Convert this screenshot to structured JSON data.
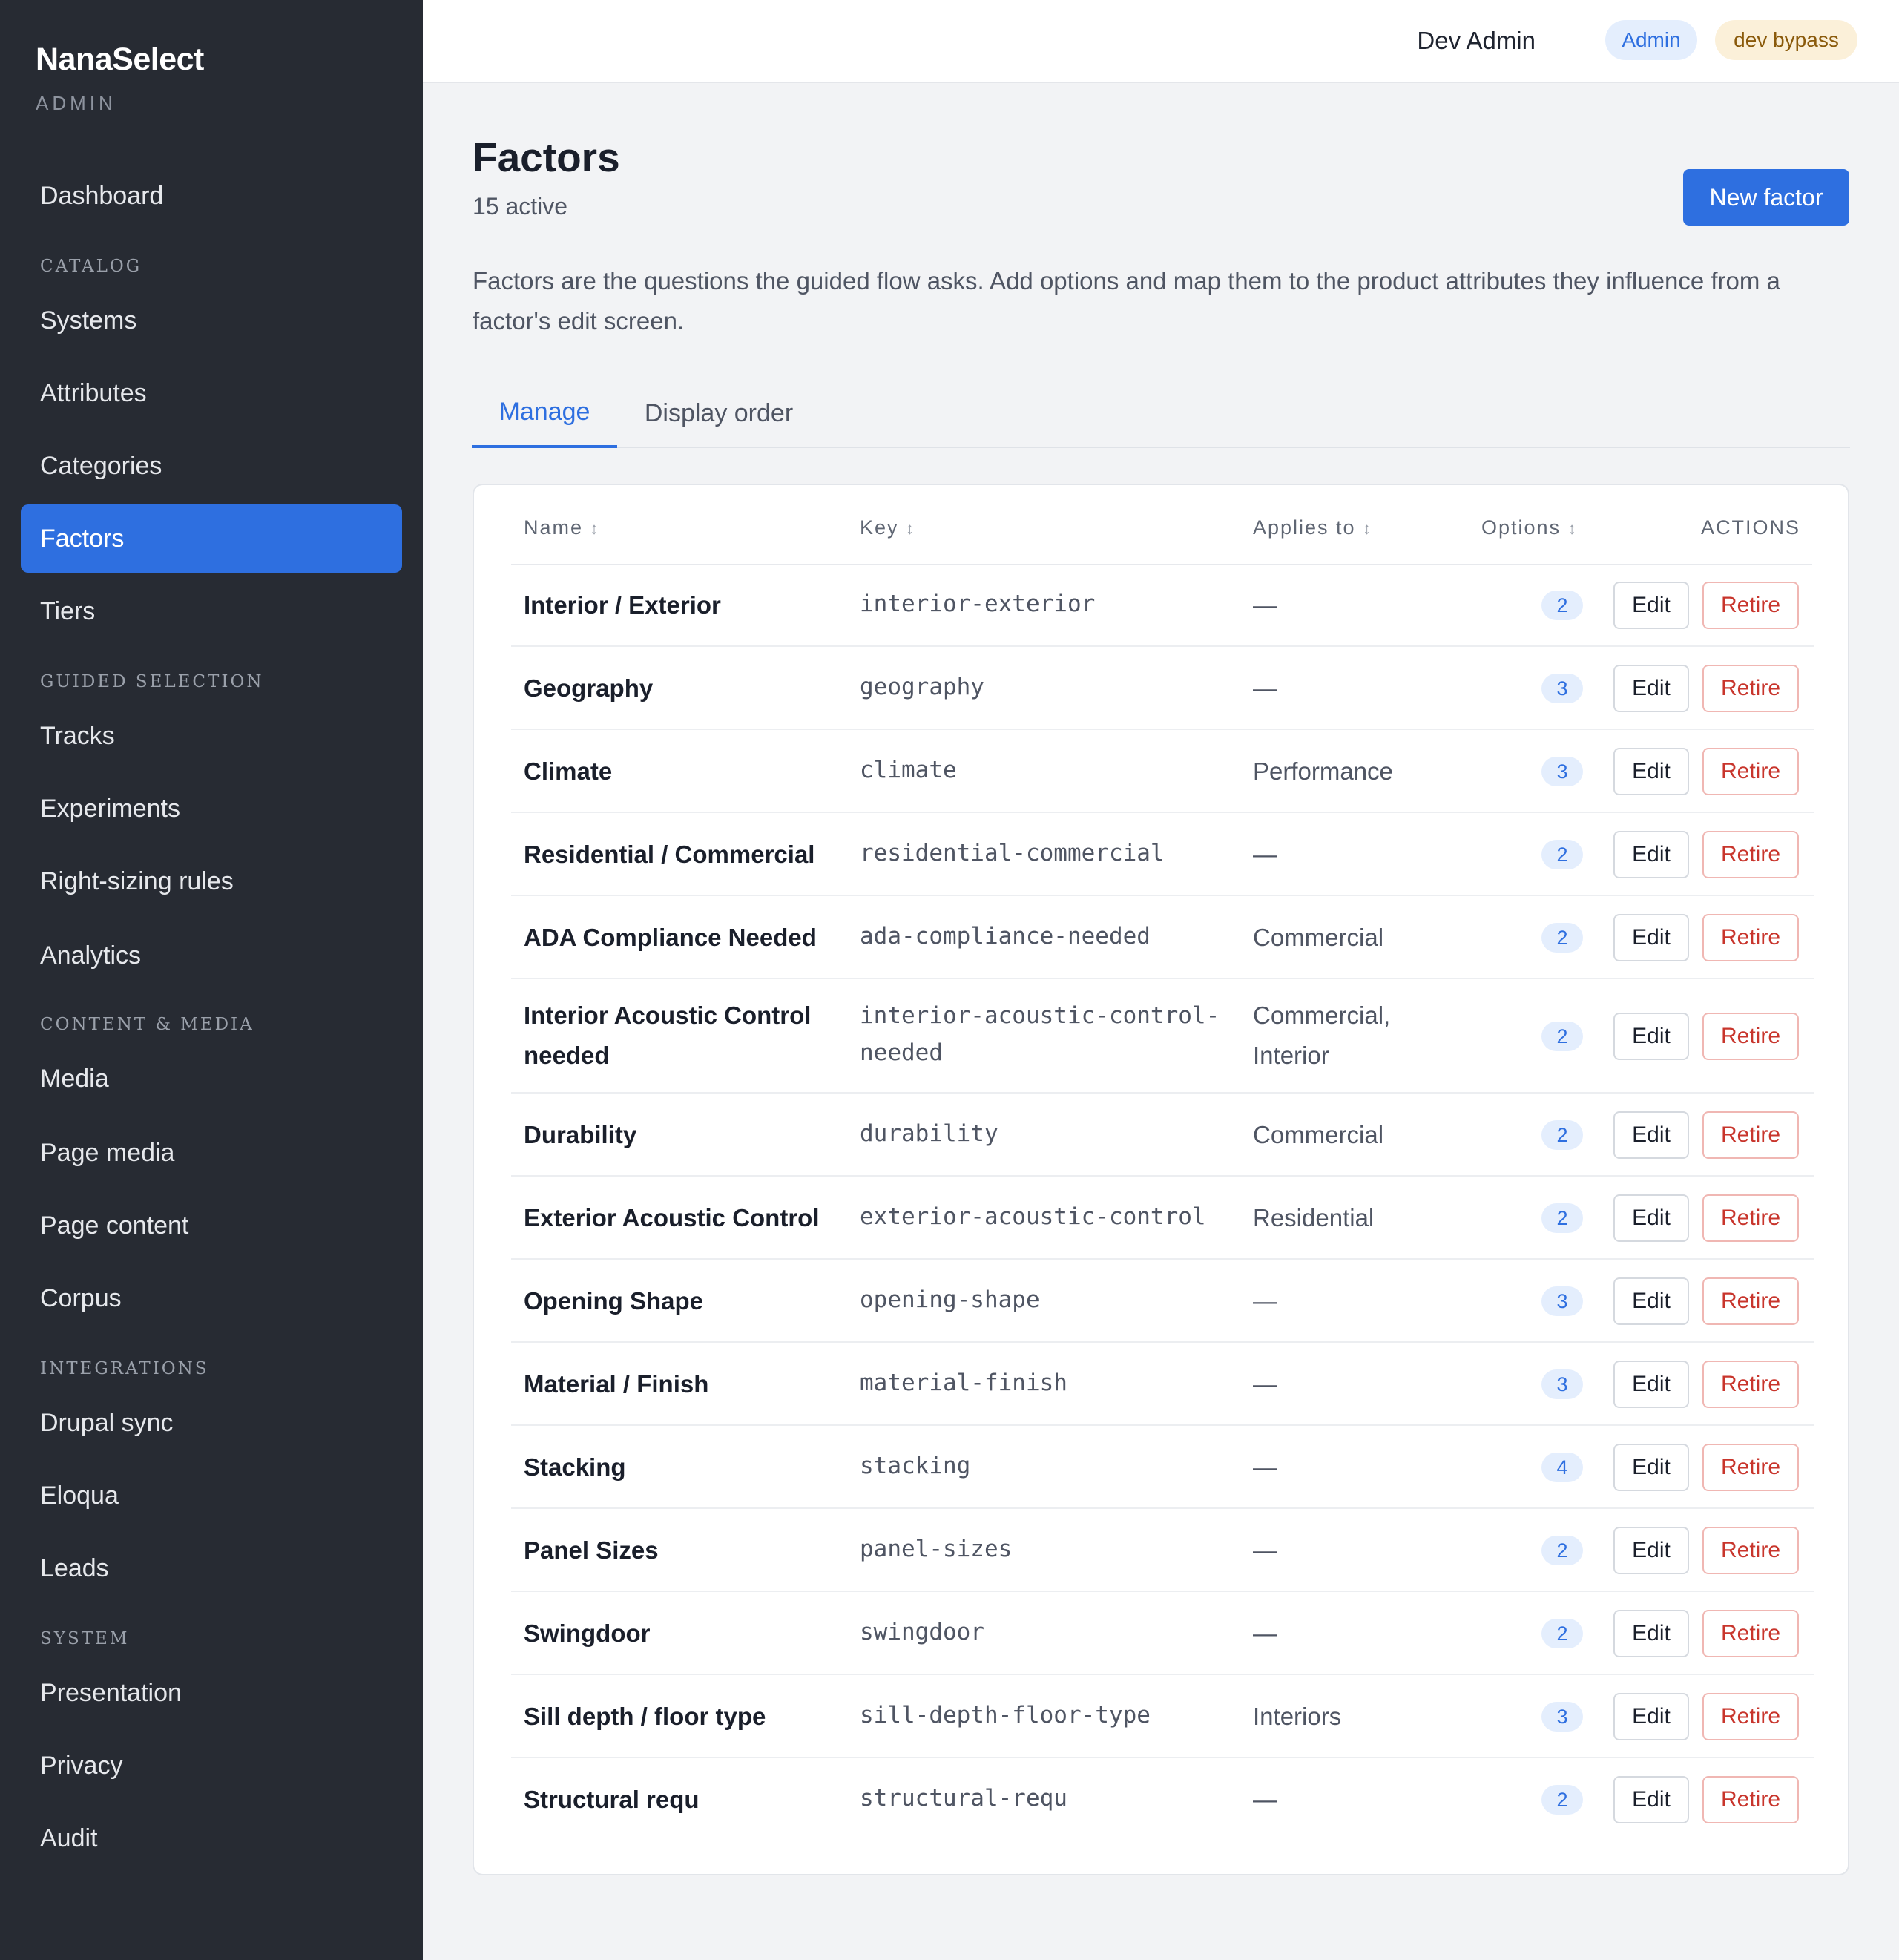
{
  "sidebar": {
    "brand": "NanaSelect",
    "brand_sub": "ADMIN",
    "dashboard": "Dashboard",
    "sections": {
      "catalog": "CATALOG",
      "guided": "GUIDED SELECTION",
      "content": "CONTENT & MEDIA",
      "integrations": "INTEGRATIONS",
      "system": "SYSTEM"
    },
    "items": {
      "systems": "Systems",
      "attributes": "Attributes",
      "categories": "Categories",
      "factors": "Factors",
      "tiers": "Tiers",
      "tracks": "Tracks",
      "experiments": "Experiments",
      "right_sizing": "Right-sizing rules",
      "analytics": "Analytics",
      "media": "Media",
      "page_media": "Page media",
      "page_content": "Page content",
      "corpus": "Corpus",
      "drupal": "Drupal sync",
      "eloqua": "Eloqua",
      "leads": "Leads",
      "presentation": "Presentation",
      "privacy": "Privacy",
      "audit": "Audit"
    }
  },
  "header": {
    "user": "Dev Admin",
    "role_badge": "Admin",
    "bypass_badge": "dev bypass"
  },
  "main": {
    "title": "Factors",
    "subtitle": "15 active",
    "new_button": "New factor",
    "description": "Factors are the questions the guided flow asks. Add options and map them to the product attributes they influence from a factor's edit screen.",
    "tabs": {
      "manage": "Manage",
      "order": "Display order"
    }
  },
  "table": {
    "headers": {
      "name": "Name",
      "key": "Key",
      "applies": "Applies to",
      "options": "Options",
      "actions": "ACTIONS",
      "sort_glyph": "↕"
    },
    "edit_label": "Edit",
    "retire_label": "Retire",
    "rows": [
      {
        "name": "Interior / Exterior",
        "key": "interior-exterior",
        "applies": "—",
        "options": "2"
      },
      {
        "name": "Geography",
        "key": "geography",
        "applies": "—",
        "options": "3"
      },
      {
        "name": "Climate",
        "key": "climate",
        "applies": "Performance",
        "options": "3"
      },
      {
        "name": "Residential / Commercial",
        "key": "residential-commercial",
        "applies": "—",
        "options": "2"
      },
      {
        "name": "ADA Compliance Needed",
        "key": "ada-compliance-needed",
        "applies": "Commercial",
        "options": "2"
      },
      {
        "name": "Interior Acoustic Control needed",
        "key": "interior-acoustic-control-needed",
        "applies": "Commercial, Interior",
        "options": "2"
      },
      {
        "name": "Durability",
        "key": "durability",
        "applies": "Commercial",
        "options": "2"
      },
      {
        "name": "Exterior Acoustic Control",
        "key": "exterior-acoustic-control",
        "applies": "Residential",
        "options": "2"
      },
      {
        "name": "Opening Shape",
        "key": "opening-shape",
        "applies": "—",
        "options": "3"
      },
      {
        "name": "Material / Finish",
        "key": "material-finish",
        "applies": "—",
        "options": "3"
      },
      {
        "name": "Stacking",
        "key": "stacking",
        "applies": "—",
        "options": "4"
      },
      {
        "name": "Panel Sizes",
        "key": "panel-sizes",
        "applies": "—",
        "options": "2"
      },
      {
        "name": "Swingdoor",
        "key": "swingdoor",
        "applies": "—",
        "options": "2"
      },
      {
        "name": "Sill depth / floor type",
        "key": "sill-depth-floor-type",
        "applies": "Interiors",
        "options": "3"
      },
      {
        "name": "Structural requ",
        "key": "structural-requ",
        "applies": "—",
        "options": "2"
      }
    ]
  },
  "colors": {
    "sidebar_bg": "#272b33",
    "accent": "#2e6fe0",
    "danger": "#c8352c",
    "page_bg": "#f2f3f5"
  }
}
